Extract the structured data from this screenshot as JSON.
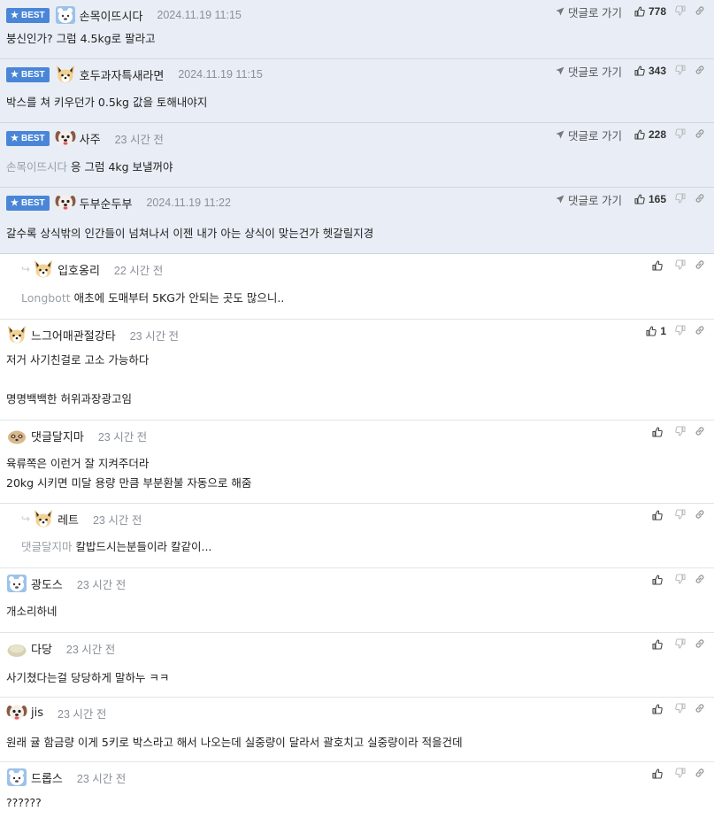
{
  "labels": {
    "best": "BEST",
    "reply_link": "댓글로 가기"
  },
  "colors": {
    "best_bg": "#e9eef6",
    "best_badge": "#4a86d8",
    "mention": "#9aa0a8",
    "time": "#8a8f98"
  },
  "comments": [
    {
      "best": true,
      "reply": false,
      "avatar": "bear-icon",
      "nick": "손목이뜨시다",
      "time": "2024.11.19 11:15",
      "likes": "778",
      "mention": "",
      "lines": [
        "붕신인가? 그럼 4.5kg로 팔라고"
      ]
    },
    {
      "best": true,
      "reply": false,
      "avatar": "fox-icon",
      "nick": "호두과자특새라면",
      "time": "2024.11.19 11:15",
      "likes": "343",
      "mention": "",
      "lines": [
        "박스를 쳐 키우던가 0.5kg 값을 토해내야지"
      ]
    },
    {
      "best": true,
      "reply": false,
      "avatar": "dog-icon",
      "nick": "사주",
      "time": "23 시간 전",
      "likes": "228",
      "mention": "손목이뜨시다",
      "lines": [
        "응 그럼 4kg 보낼꺼야"
      ]
    },
    {
      "best": true,
      "reply": false,
      "avatar": "dog-icon",
      "nick": "두부순두부",
      "time": "2024.11.19 11:22",
      "likes": "165",
      "mention": "",
      "lines": [
        "갈수록 상식밖의 인간들이 넘쳐나서 이젠 내가 아는 상식이 맞는건가 헷갈릴지경"
      ]
    },
    {
      "best": false,
      "reply": true,
      "avatar": "fox-icon",
      "nick": "입호옹리",
      "time": "22 시간 전",
      "likes": "",
      "mention": "Longbott",
      "lines": [
        "애초에 도매부터 5KG가 안되는 곳도 많으니.."
      ]
    },
    {
      "best": false,
      "reply": false,
      "avatar": "fox-icon",
      "nick": "느그어매관절강타",
      "time": "23 시간 전",
      "likes": "1",
      "mention": "",
      "lines": [
        "저거 사기친걸로 고소 가능하다",
        "",
        "명명백백한 허위과장광고임"
      ]
    },
    {
      "best": false,
      "reply": false,
      "avatar": "meerkat-icon",
      "nick": "댓글달지마",
      "time": "23 시간 전",
      "likes": "",
      "mention": "",
      "lines": [
        "육류쪽은 이런거 잘 지켜주더라",
        "20kg 시키면 미달 용량 만큼 부분환불 자동으로 해줌"
      ]
    },
    {
      "best": false,
      "reply": true,
      "avatar": "fox-icon",
      "nick": "레트",
      "time": "23 시간 전",
      "likes": "",
      "mention": "댓글달지마",
      "lines": [
        "칼밥드시는분들이라 칼같이..."
      ]
    },
    {
      "best": false,
      "reply": false,
      "avatar": "bear-icon",
      "nick": "광도스",
      "time": "23 시간 전",
      "likes": "",
      "mention": "",
      "lines": [
        "개소리하네"
      ]
    },
    {
      "best": false,
      "reply": false,
      "avatar": "blob-icon",
      "nick": "다당",
      "time": "23 시간 전",
      "likes": "",
      "mention": "",
      "lines": [
        "사기쳤다는걸 당당하게 말하누 ㅋㅋ"
      ]
    },
    {
      "best": false,
      "reply": false,
      "avatar": "dog-icon",
      "nick": "jis",
      "time": "23 시간 전",
      "likes": "",
      "mention": "",
      "lines": [
        "원래 귤 함금량 이게 5키로 박스라고 해서 나오는데 실중량이 달라서 괄호치고 실중량이라 적을건데"
      ]
    },
    {
      "best": false,
      "reply": false,
      "avatar": "bear-icon",
      "nick": "드롭스",
      "time": "23 시간 전",
      "likes": "",
      "mention": "",
      "lines": [
        "??????"
      ]
    }
  ]
}
